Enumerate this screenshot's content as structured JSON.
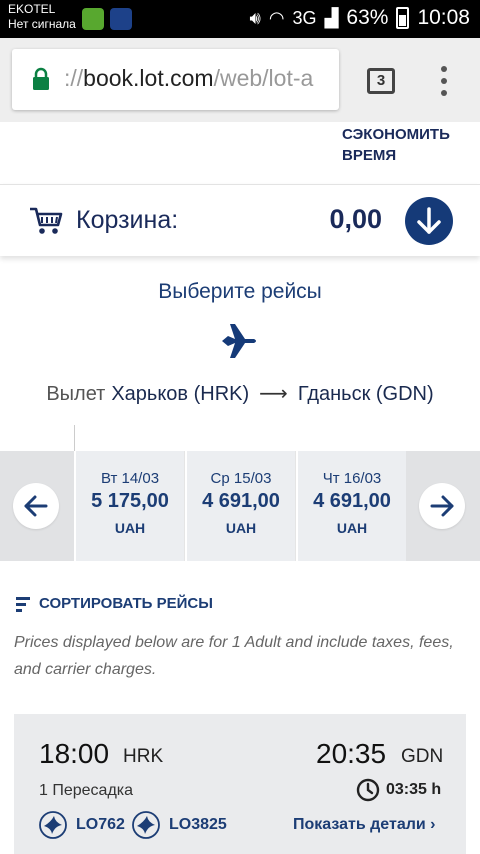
{
  "status_bar": {
    "carrier": "EKOTEL",
    "signal_text": "Нет сигнала",
    "network": "3G",
    "battery": "63%",
    "time": "10:08"
  },
  "browser": {
    "url_prefix": "://",
    "url_host": "book.lot.com",
    "url_path": "/web/lot-a",
    "tab_count": "3"
  },
  "page": {
    "save_time": "СЭКОНОМИТЬ ВРЕМЯ",
    "cart": {
      "label": "Корзина:",
      "amount": "0,00"
    },
    "select_title": "Выберите рейсы",
    "route": {
      "label": "Вылет",
      "from": "Харьков (HRK)",
      "arrow": "⟶",
      "to": "Гданьск (GDN)"
    },
    "dates": [
      {
        "day": "Вт 14/03",
        "price": "5 175,00",
        "currency": "UAH"
      },
      {
        "day": "Ср 15/03",
        "price": "4 691,00",
        "currency": "UAH"
      },
      {
        "day": "Чт 16/03",
        "price": "4 691,00",
        "currency": "UAH"
      }
    ],
    "sort_label": "СОРТИРОВАТЬ РЕЙСЫ",
    "disclaimer": "Prices displayed below are for 1 Adult and include taxes, fees, and carrier charges.",
    "flight": {
      "dep_time": "18:00",
      "dep_code": "HRK",
      "arr_time": "20:35",
      "arr_code": "GDN",
      "stops": "1 Пересадка",
      "duration": "03:35 h",
      "flight_numbers": [
        "LO762",
        "LO3825"
      ],
      "details_link": "Показать детали ›"
    }
  },
  "colors": {
    "brand_navy": "#153a78",
    "status_green": "#58a82f"
  },
  "icons": [
    "lock-icon",
    "cart-icon",
    "arrow-down-icon",
    "plane-icon",
    "arrow-left-icon",
    "arrow-right-icon",
    "sort-icon",
    "clock-icon",
    "lot-crane-logo-icon"
  ]
}
